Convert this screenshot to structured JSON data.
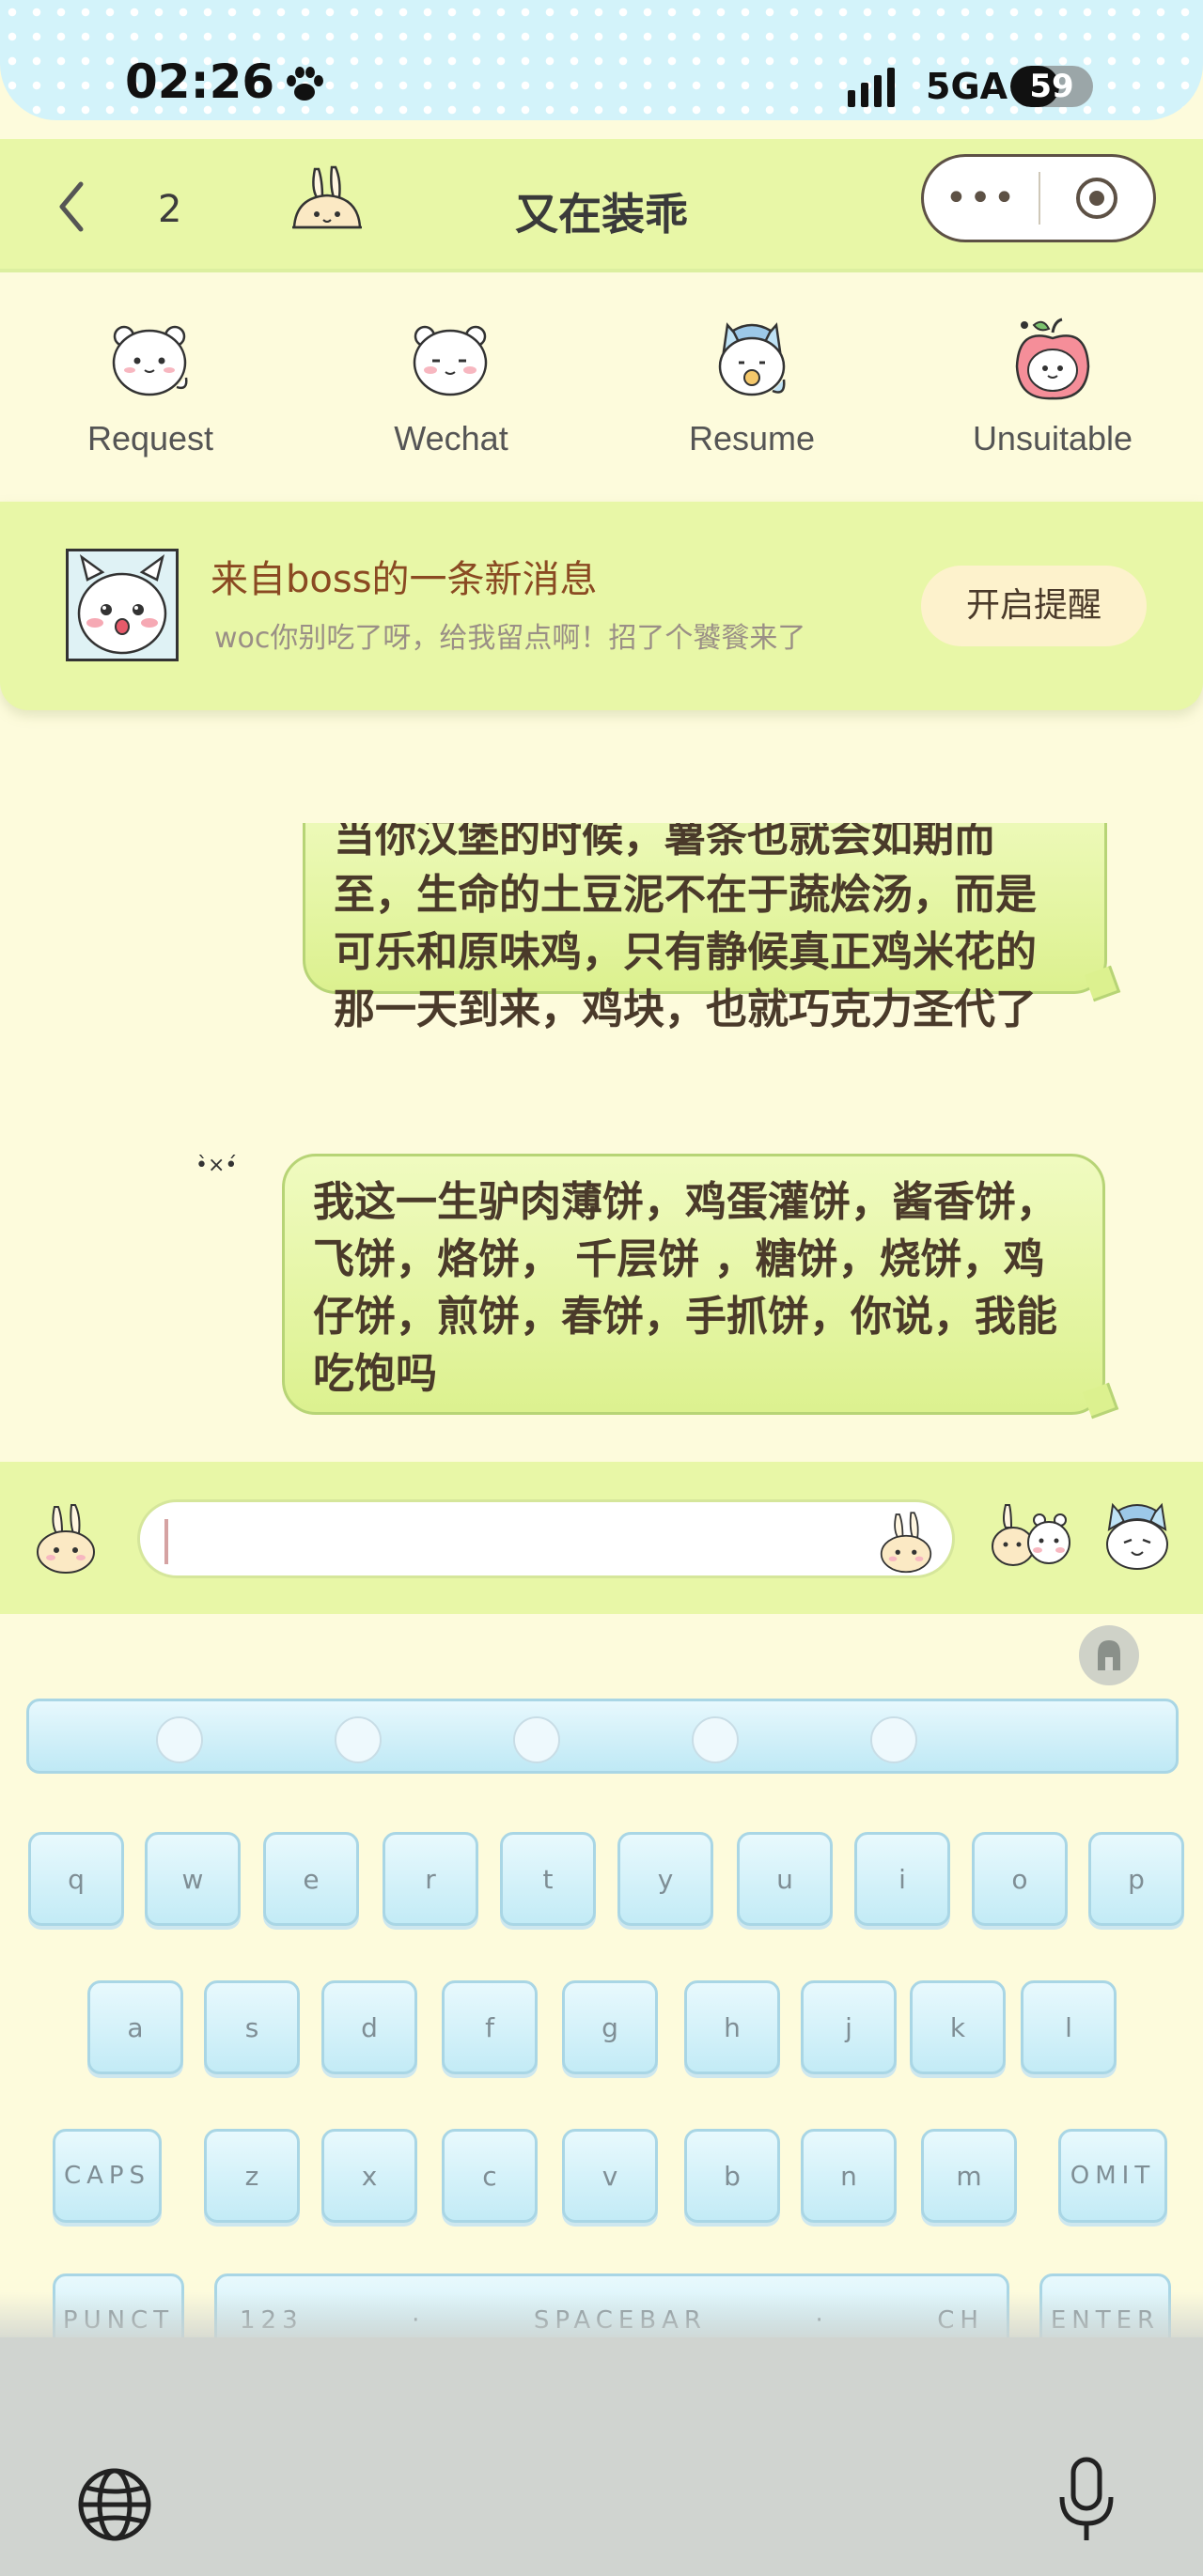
{
  "status_bar": {
    "time": "02:26",
    "network": "5GA",
    "battery": "59",
    "battery_level": 0.59
  },
  "nav": {
    "unread_count": "2",
    "title": "又在装乖",
    "more_label": "•••"
  },
  "tabs": [
    {
      "label": "Request",
      "icon": "bear-face-icon"
    },
    {
      "label": "Wechat",
      "icon": "bear-blush-icon"
    },
    {
      "label": "Resume",
      "icon": "cat-hat-icon"
    },
    {
      "label": "Unsuitable",
      "icon": "apple-bear-icon"
    }
  ],
  "notification": {
    "title": "来自boss的一条新消息",
    "message": "woc你别吃了呀，给我留点啊！招了个饕餮来了",
    "remind_button": "开启提醒"
  },
  "chat": {
    "messages": [
      {
        "text": "当你汉堡的时候，薯条也就会如期而至，生命的土豆泥不在于蔬烩汤，而是可乐和原味鸡，只有静候真正鸡米花的那一天到来，鸡块，也就巧克力圣代了"
      },
      {
        "text": "我这一生驴肉薄饼，鸡蛋灌饼，酱香饼，飞饼，烙饼， 千层饼 ，糖饼，烧饼，鸡仔饼，煎饼，春饼，手抓饼，你说，我能吃饱吗"
      }
    ],
    "emoticon": "•̀×•́"
  },
  "keyboard": {
    "row1": [
      "q",
      "w",
      "e",
      "r",
      "t",
      "y",
      "u",
      "i",
      "o",
      "p"
    ],
    "row2": [
      "a",
      "s",
      "d",
      "f",
      "g",
      "h",
      "j",
      "k",
      "l"
    ],
    "row3": [
      "CAPS",
      "z",
      "x",
      "c",
      "v",
      "b",
      "n",
      "m",
      "OMIT"
    ],
    "punct": "PUNCT",
    "numbers": "123",
    "spacebar": "SPACEBAR",
    "lang": "CH",
    "enter": "ENTER"
  }
}
